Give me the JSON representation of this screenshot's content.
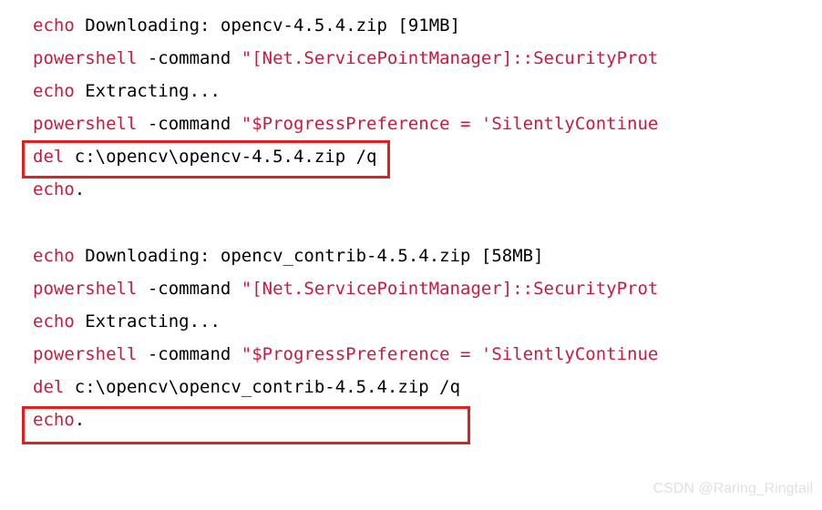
{
  "lines": {
    "l1_kw": "echo",
    "l1_txt": " Downloading: opencv-4.5.4.zip [91MB]",
    "l2_kw": "powershell",
    "l2_txt": " -command ",
    "l2_str": "\"[Net.ServicePointManager]::SecurityProt",
    "l3_kw": "echo",
    "l3_txt": " Extracting...",
    "l4_kw": "powershell",
    "l4_txt": " -command ",
    "l4_str": "\"$ProgressPreference = 'SilentlyContinue",
    "l5_kw": "del",
    "l5_txt": " c:\\opencv\\opencv-4.5.4.zip /q",
    "l6_kw": "echo",
    "l6_txt": ".",
    "l7_kw": "echo",
    "l7_txt": " Downloading: opencv_contrib-4.5.4.zip [58MB]",
    "l8_kw": "powershell",
    "l8_txt": " -command ",
    "l8_str": "\"[Net.ServicePointManager]::SecurityProt",
    "l9_kw": "echo",
    "l9_txt": " Extracting...",
    "l10_kw": "powershell",
    "l10_txt": " -command ",
    "l10_str": "\"$ProgressPreference = 'SilentlyContinue",
    "l11_kw": "del",
    "l11_txt": " c:\\opencv\\opencv_contrib-4.5.4.zip /q",
    "l12_kw": "echo",
    "l12_txt": "."
  },
  "watermark": "CSDN @Raring_Ringtail"
}
